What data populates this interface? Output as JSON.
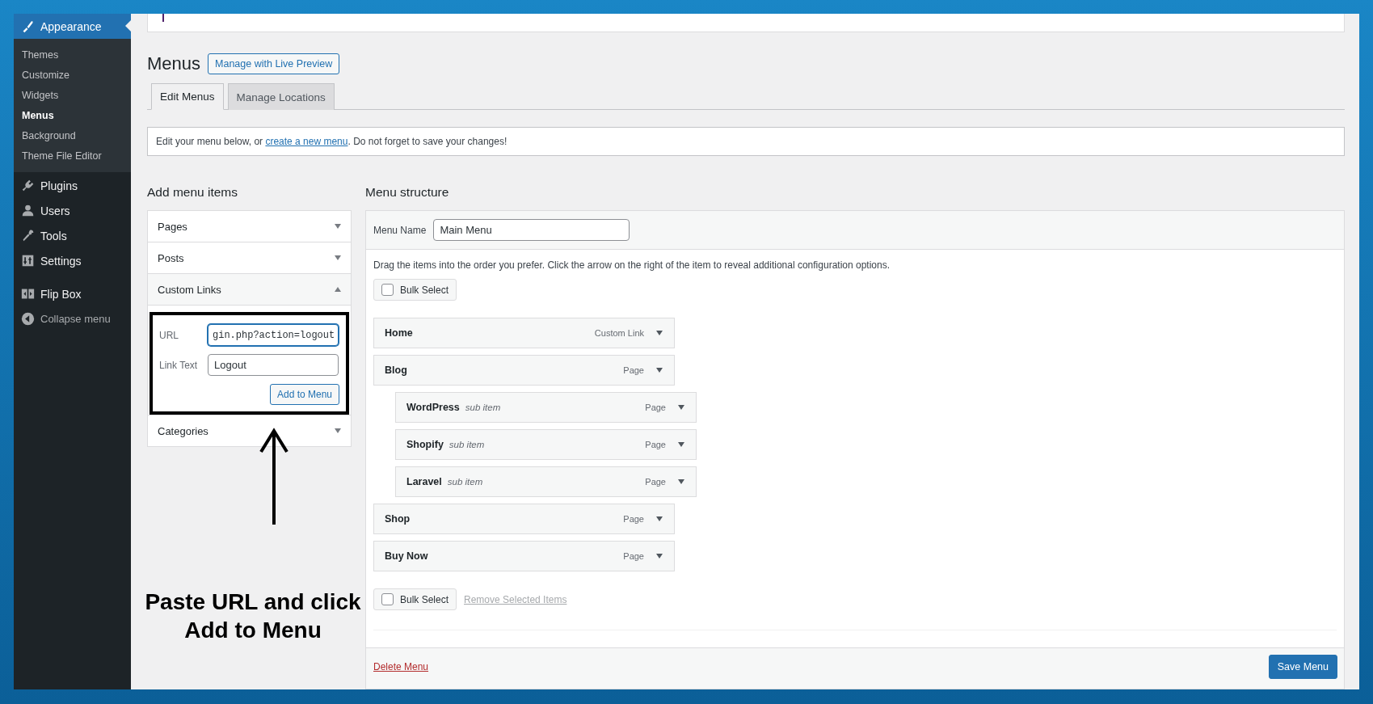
{
  "sidebar": {
    "items": [
      {
        "label": "Appearance",
        "selected": true,
        "children": [
          {
            "label": "Themes",
            "selected": false
          },
          {
            "label": "Customize",
            "selected": false
          },
          {
            "label": "Widgets",
            "selected": false
          },
          {
            "label": "Menus",
            "selected": true
          },
          {
            "label": "Background",
            "selected": false
          },
          {
            "label": "Theme File Editor",
            "selected": false
          }
        ]
      },
      {
        "label": "Plugins",
        "selected": false
      },
      {
        "label": "Users",
        "selected": false
      },
      {
        "label": "Tools",
        "selected": false
      },
      {
        "label": "Settings",
        "selected": false
      },
      {
        "label": "Flip Box",
        "selected": false
      },
      {
        "label": "Collapse menu",
        "selected": false
      }
    ]
  },
  "page": {
    "title": "Menus",
    "action": "Manage with Live Preview"
  },
  "tabs": [
    {
      "label": "Edit Menus",
      "selected": true
    },
    {
      "label": "Manage Locations",
      "selected": false
    }
  ],
  "notice": {
    "before": "Edit your menu below, or ",
    "link": "create a new menu",
    "after": ". Do not forget to save your changes!"
  },
  "add_menu_items": {
    "title": "Add menu items",
    "sections": [
      {
        "label": "Pages",
        "expanded": false
      },
      {
        "label": "Posts",
        "expanded": false
      },
      {
        "label": "Custom Links",
        "expanded": true,
        "fields": [
          {
            "label": "URL",
            "value": "gin.php?action=logout",
            "focused": true
          },
          {
            "label": "Link Text",
            "value": "Logout",
            "focused": false
          }
        ],
        "button": "Add to Menu"
      },
      {
        "label": "Categories",
        "expanded": false
      }
    ]
  },
  "menu_structure": {
    "title": "Menu structure",
    "menu_name_label": "Menu Name",
    "menu_name": "Main Menu",
    "instructions": "Drag the items into the order you prefer. Click the arrow on the right of the item to reveal additional configuration options.",
    "bulk_select_top": {
      "label": "Bulk Select",
      "checked": false
    },
    "items": [
      {
        "title": "Home",
        "type": "Custom Link"
      },
      {
        "title": "Blog",
        "type": "Page",
        "children": [
          {
            "title": "WordPress",
            "note": "sub item",
            "type": "Page"
          },
          {
            "title": "Shopify",
            "note": "sub item",
            "type": "Page"
          },
          {
            "title": "Laravel",
            "note": "sub item",
            "type": "Page"
          }
        ]
      },
      {
        "title": "Shop",
        "type": "Page"
      },
      {
        "title": "Buy Now",
        "type": "Page"
      }
    ],
    "bulk_select_bottom": {
      "label": "Bulk Select",
      "checked": false
    },
    "remove_link": "Remove Selected Items",
    "delete_link": "Delete Menu",
    "save_button": "Save Menu"
  },
  "annotation": {
    "text": "Paste URL and click Add to Menu"
  }
}
